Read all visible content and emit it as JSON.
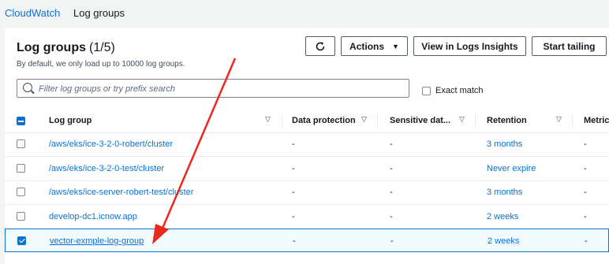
{
  "breadcrumb": {
    "root": "CloudWatch",
    "separator": "›",
    "current": "Log groups"
  },
  "header": {
    "title": "Log groups",
    "count": "(1/5)",
    "description": "By default, we only load up to 10000 log groups."
  },
  "toolbar": {
    "refresh_icon": "refresh-icon",
    "actions_label": "Actions",
    "insights_label": "View in Logs Insights",
    "tail_label": "Start tailing"
  },
  "search": {
    "placeholder": "Filter log groups or try prefix search",
    "value": ""
  },
  "exact_match": {
    "label": "Exact match",
    "checked": false
  },
  "columns": [
    "Log group",
    "Data protection",
    "Sensitive dat...",
    "Retention",
    "Metric"
  ],
  "rows": [
    {
      "name": "/aws/eks/ice-3-2-0-robert/cluster",
      "data_protection": "-",
      "sensitive": "-",
      "retention": "3 months",
      "metric": "-",
      "selected": false
    },
    {
      "name": "/aws/eks/ice-3-2-0-test/cluster",
      "data_protection": "-",
      "sensitive": "-",
      "retention": "Never expire",
      "metric": "-",
      "selected": false
    },
    {
      "name": "/aws/eks/ice-server-robert-test/cluster",
      "data_protection": "-",
      "sensitive": "-",
      "retention": "3 months",
      "metric": "-",
      "selected": false
    },
    {
      "name": "develop-dc1.icnow.app",
      "data_protection": "-",
      "sensitive": "-",
      "retention": "2 weeks",
      "metric": "-",
      "selected": false
    },
    {
      "name": "vector-exmple-log-group",
      "data_protection": "-",
      "sensitive": "-",
      "retention": "2 weeks",
      "metric": "-",
      "selected": true
    }
  ],
  "colors": {
    "accent": "#0972d3",
    "annotation_arrow": "#e8291c"
  }
}
